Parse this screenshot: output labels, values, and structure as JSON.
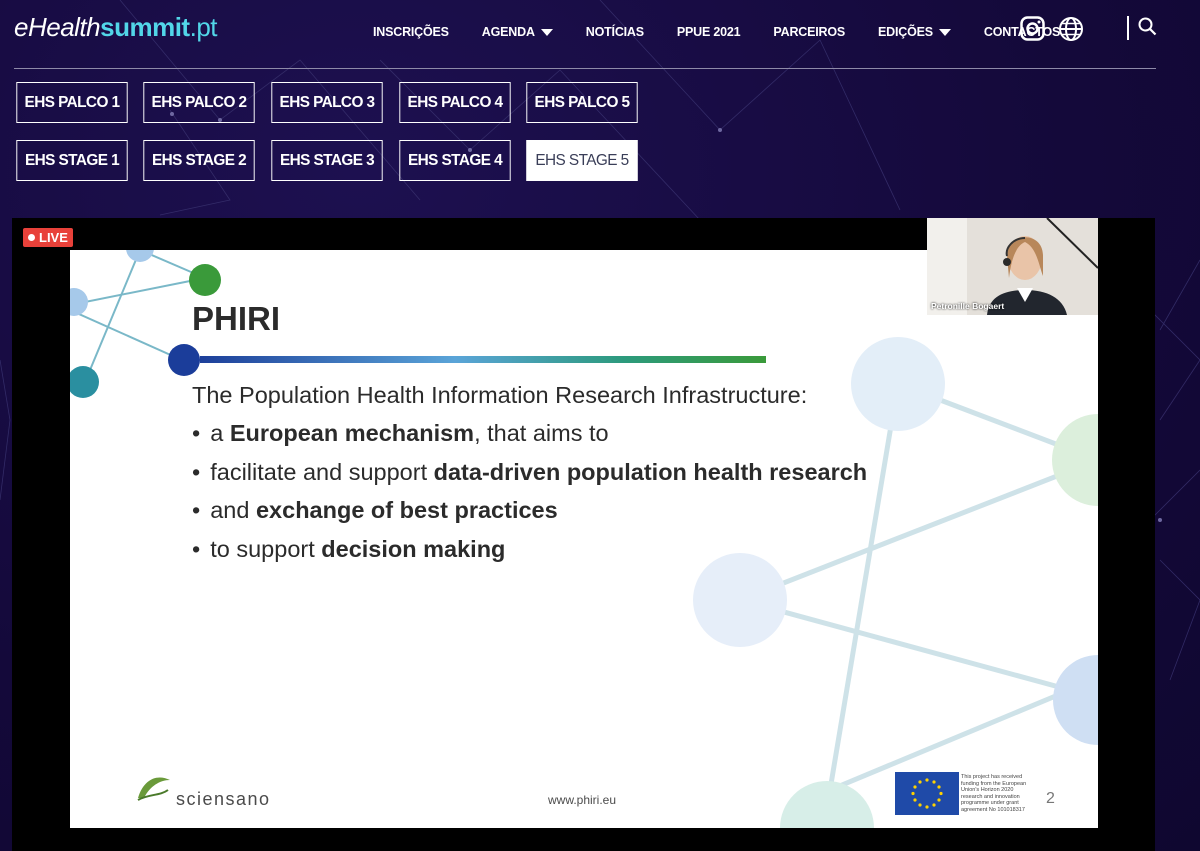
{
  "header": {
    "logo": {
      "part1": "eHealth",
      "part2": "summit",
      "part3": ".pt"
    },
    "nav": [
      {
        "label": "INSCRIÇÕES",
        "dropdown": false
      },
      {
        "label": "AGENDA",
        "dropdown": true
      },
      {
        "label": "NOTÍCIAS",
        "dropdown": false
      },
      {
        "label": "PPUE 2021",
        "dropdown": false
      },
      {
        "label": "PARCEIROS",
        "dropdown": false
      },
      {
        "label": "EDIÇÕES",
        "dropdown": true
      },
      {
        "label": "CONTACTOS",
        "dropdown": false
      }
    ],
    "icons": [
      "instagram-icon",
      "globe-icon",
      "search-icon"
    ]
  },
  "stages": {
    "row1": [
      "EHS PALCO 1",
      "EHS PALCO 2",
      "EHS PALCO 3",
      "EHS PALCO 4",
      "EHS PALCO 5"
    ],
    "row2": [
      "EHS STAGE 1",
      "EHS STAGE 2",
      "EHS STAGE 3",
      "EHS STAGE 4",
      "EHS STAGE 5"
    ],
    "active": "EHS STAGE 5"
  },
  "video": {
    "live_label": "LIVE",
    "speaker_name": "Petronille Bogaert",
    "slide": {
      "title": "PHIRI",
      "intro": "The Population Health Information Research Infrastructure:",
      "bullets": [
        {
          "pre": "a ",
          "bold": "European mechanism",
          "post": ", that aims to"
        },
        {
          "pre": "facilitate and support ",
          "bold": "data-driven population health research",
          "post": ""
        },
        {
          "pre": "and ",
          "bold": "exchange of best practices",
          "post": ""
        },
        {
          "pre": "to support ",
          "bold": "decision making",
          "post": ""
        }
      ],
      "footer_logo": "sciensano",
      "footer_url": "www.phiri.eu",
      "eu_notice": "This project has received funding from the European Union's Horizon 2020 research and innovation programme under grant agreement No 101018317",
      "page_number": "2"
    }
  },
  "colors": {
    "background": "#14093a",
    "accent": "#52d6e8",
    "live": "#e8413a",
    "title_bar_start": "#1d3f9a",
    "title_bar_end": "#3a9a3a"
  }
}
